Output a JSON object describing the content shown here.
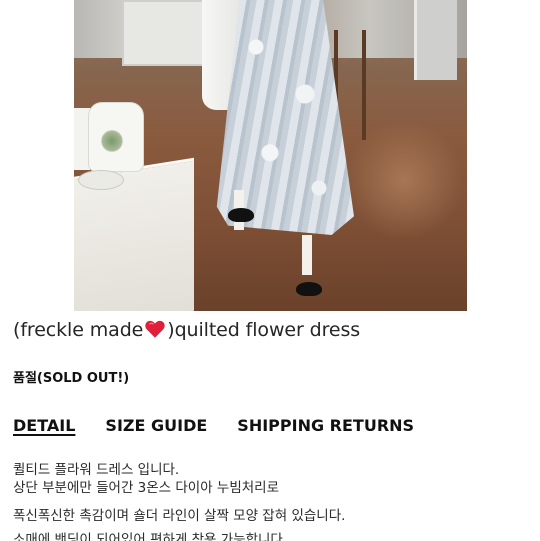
{
  "product": {
    "title_before_icon": "(freckle made",
    "title_icon": "heart-icon",
    "title_after_icon": ")quilted flower dress",
    "stock_status": "품절(SOLD OUT!)"
  },
  "tabs": [
    {
      "label": "DETAIL",
      "active": true
    },
    {
      "label": "SIZE GUIDE",
      "active": false
    },
    {
      "label": "SHIPPING RETURNS",
      "active": false
    }
  ],
  "description": {
    "lines": [
      "퀼티드 플라워 드레스 입니다.",
      "상단 부분에만 들어간 3온스 다이아 누빔처리로",
      "폭신폭신한 촉감이며 숄더 라인이 살짝 모양 잡혀 있습니다.",
      "소매에 밴딩이 되어있어 편하게 착용 가능합니다."
    ]
  },
  "colors": {
    "heart": "#e0203a",
    "text": "#1e1e1e"
  }
}
